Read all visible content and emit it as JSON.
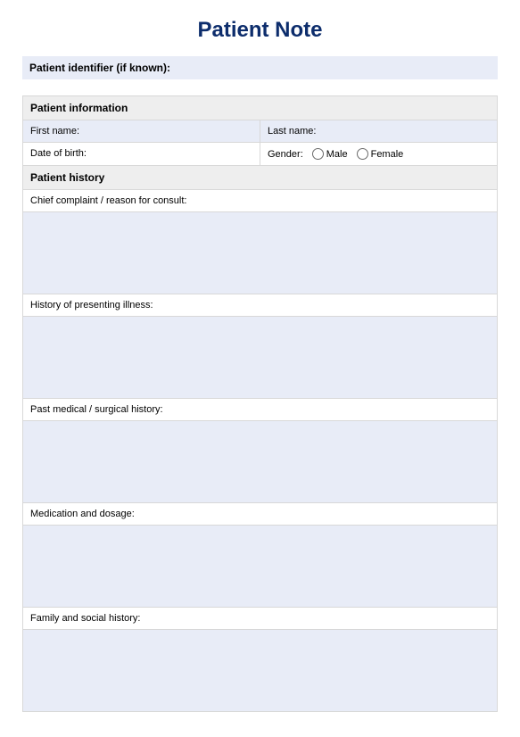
{
  "title": "Patient Note",
  "identifier_label": "Patient identifier (if known):",
  "sections": {
    "info_header": "Patient information",
    "history_header": "Patient history"
  },
  "fields": {
    "first_name": "First name:",
    "last_name": "Last name:",
    "dob": "Date of birth:",
    "gender_label": "Gender:",
    "male": "Male",
    "female": "Female",
    "chief_complaint": "Chief complaint / reason for consult:",
    "hpi": "History of presenting illness:",
    "pmh": "Past medical / surgical history:",
    "medication": "Medication and dosage:",
    "family_social": "Family and social history:"
  }
}
